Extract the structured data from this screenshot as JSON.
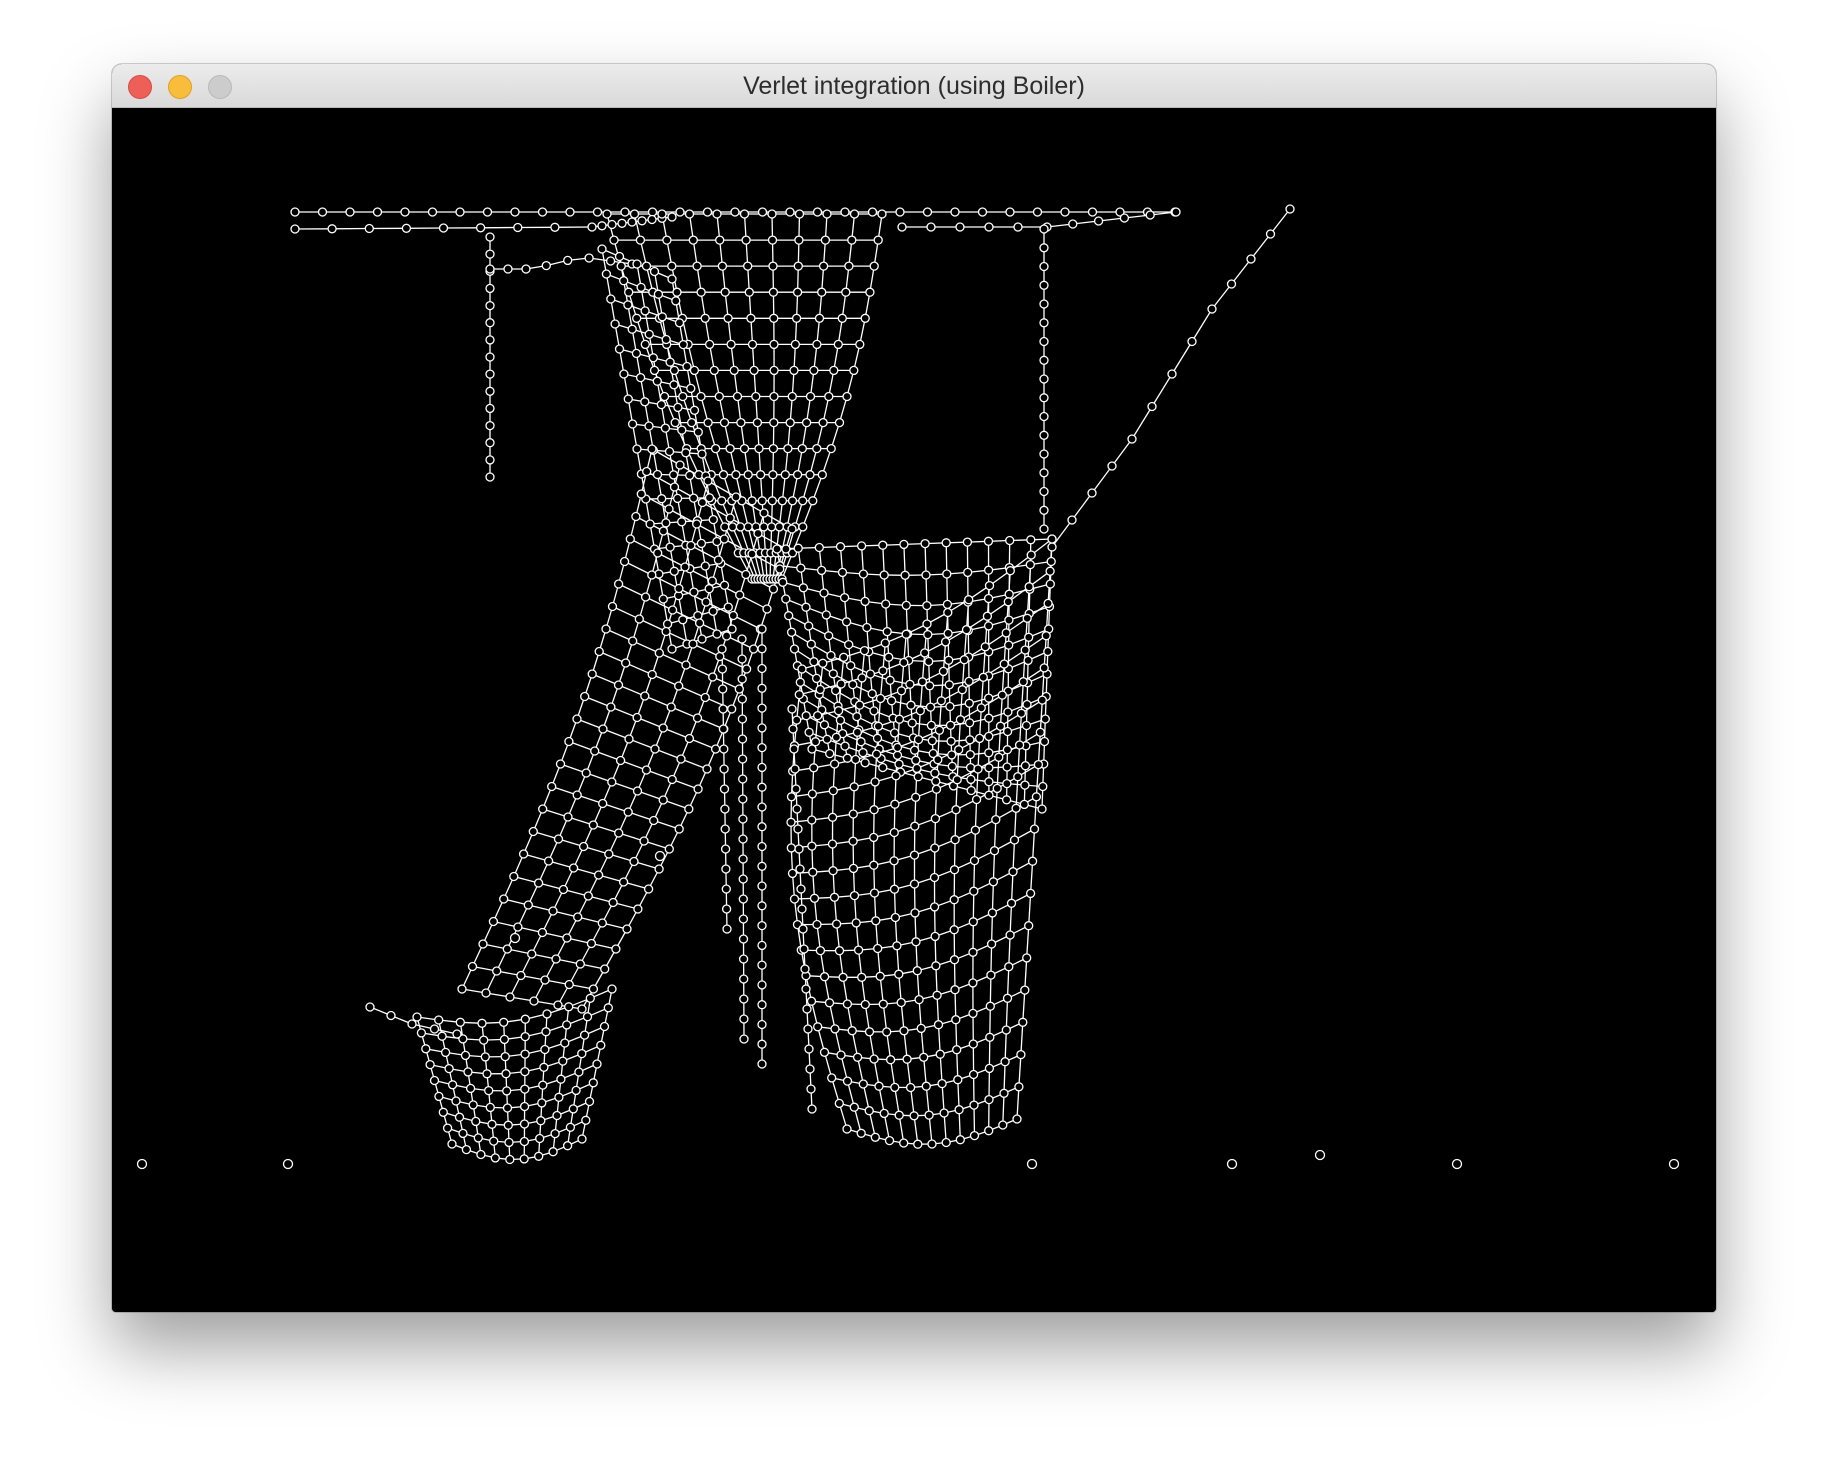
{
  "window": {
    "title": "Verlet integration (using Boiler)"
  },
  "controls": {
    "close_icon": "close-icon",
    "minimize_icon": "minimize-icon",
    "zoom_icon": "zoom-icon"
  },
  "canvas": {
    "background": "#000000",
    "foreground": "#ffffff"
  }
}
